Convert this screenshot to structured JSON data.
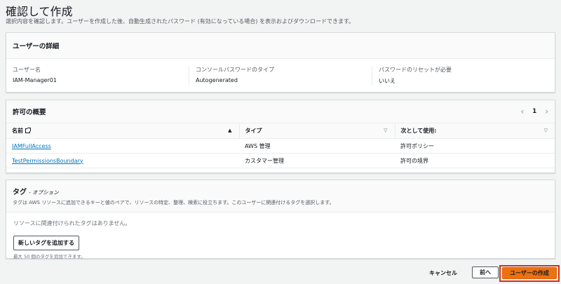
{
  "page": {
    "title": "確認して作成",
    "description": "選択内容を確認します。ユーザーを作成した後、自動生成されたパスワード (有効になっている場合) を表示およびダウンロードできます。"
  },
  "user_details": {
    "header": "ユーザーの詳細",
    "fields": [
      {
        "label": "ユーザー名",
        "value": "IAM-Manager01"
      },
      {
        "label": "コンソールパスワードのタイプ",
        "value": "Autogenerated"
      },
      {
        "label": "パスワードのリセットが必要",
        "value": "いいえ"
      }
    ]
  },
  "permissions": {
    "header": "許可の概要",
    "page_number": "1",
    "columns": [
      "名前",
      "タイプ",
      "次として使用:"
    ],
    "rows": [
      {
        "name": "IAMFullAccess",
        "type": "AWS 管理",
        "used_as": "許可ポリシー"
      },
      {
        "name": "TestPermissionsBoundary",
        "type": "カスタマー管理",
        "used_as": "許可の境界"
      }
    ]
  },
  "tags": {
    "title": "タグ",
    "optional": "- オプション",
    "description": "タグは AWS リソースに追加できるキーと値のペアで、リソースの特定、整理、検索に役立ちます。このユーザーに関連付けるタグを選択します。",
    "empty_text": "リソースに関連付けられたタグはありません。",
    "add_button": "新しいタグを追加する",
    "limit_text": "最大 50 個のタグを追加できます。"
  },
  "footer": {
    "cancel": "キャンセル",
    "previous": "前へ",
    "create": "ユーザーの作成"
  },
  "colors": {
    "primary": "#ec7211",
    "highlight": "#d13212",
    "link": "#0073bb"
  }
}
